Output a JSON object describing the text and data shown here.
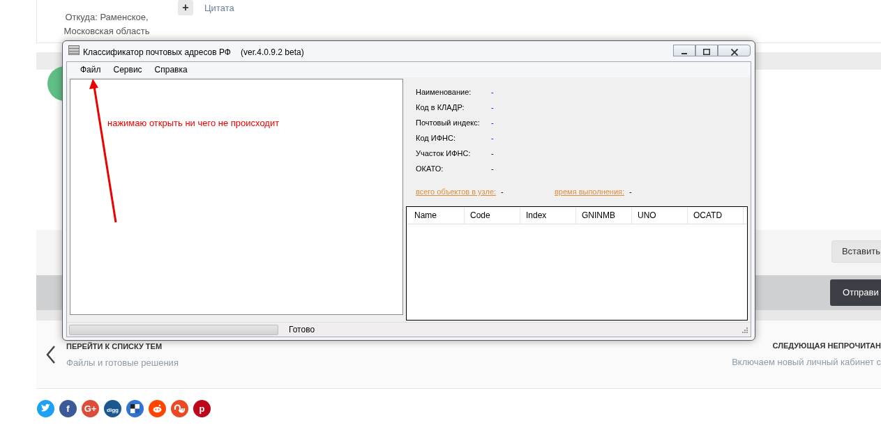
{
  "forum": {
    "author_location": "Откуда: Раменское, Московская область",
    "quote_button": {
      "icon": "+",
      "label": "Цитата"
    },
    "insert_button": "Вставить",
    "send_button": "Отправи",
    "nav": {
      "back_title": "ПЕРЕЙТИ К СПИСКУ ТЕМ",
      "back_subtitle": "Файлы и готовые решения",
      "next_title": "СЛЕДУЮЩАЯ НЕПРОЧИТАН",
      "next_subtitle": "Включаем новый личный кабинет с"
    },
    "share_icons": [
      {
        "kind": "twitter",
        "color": "#1da1f2"
      },
      {
        "kind": "glyph",
        "glyph": "f",
        "color": "#3b5998"
      },
      {
        "kind": "glyph",
        "glyph": "G+",
        "color": "#dd4b39"
      },
      {
        "kind": "glyph",
        "glyph": "digg",
        "color": "#1b5891"
      },
      {
        "kind": "delicious",
        "color": "#3274d1"
      },
      {
        "kind": "reddit",
        "color": "#ff4500"
      },
      {
        "kind": "stumble",
        "color": "#eb4924"
      },
      {
        "kind": "glyph",
        "glyph": "p",
        "color": "#bd081c"
      }
    ]
  },
  "window": {
    "title": "Классификатор почтовых адресов РФ",
    "version": "(ver.4.0.9.2 beta)",
    "menu": [
      "Файл",
      "Сервис",
      "Справка"
    ],
    "details": [
      {
        "label": "Наименование:",
        "value": "-",
        "kind": "link"
      },
      {
        "label": "Код в КЛАДР:",
        "value": "-",
        "kind": "link"
      },
      {
        "label": "Почтовый индекс:",
        "value": "-",
        "kind": "link"
      },
      {
        "label": "Код ИФНС:",
        "value": "-",
        "kind": "link"
      },
      {
        "label": "Участок ИФНС:",
        "value": "-",
        "kind": "plain"
      },
      {
        "label": "ОКАТО:",
        "value": "-",
        "kind": "plain"
      }
    ],
    "stats": [
      {
        "label": "всего объектов в узле:",
        "value": "-"
      },
      {
        "label": "время выполнения:",
        "value": "-"
      }
    ],
    "table": {
      "columns": [
        "Name",
        "Code",
        "Index",
        "GNINMB",
        "UNO",
        "OCATD"
      ]
    },
    "status_bar": {
      "text": "Готово",
      "progress": {
        "level": 0
      }
    }
  },
  "annotation": {
    "text": "нажимаю открыть ни чего не происходит"
  }
}
